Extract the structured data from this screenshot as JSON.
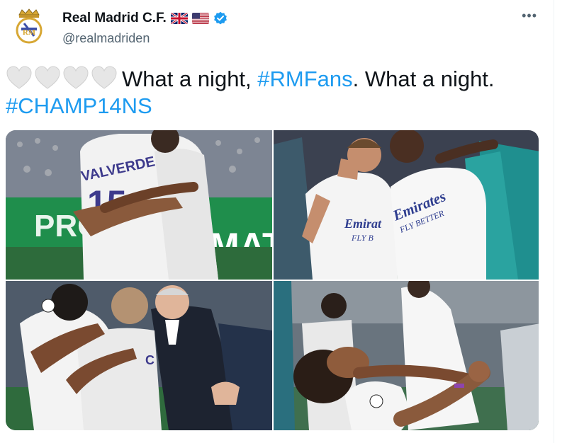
{
  "account": {
    "name": "Real Madrid C.F.",
    "handle": "@realmadriden",
    "avatar_icon": "real-madrid-crest-icon",
    "flags": [
      "uk-flag-icon",
      "us-flag-icon"
    ],
    "verified_icon": "verified-badge-icon"
  },
  "menu": {
    "more_label": "•••"
  },
  "tweet": {
    "emoji_icon": "white-heart-icon",
    "emoji_count": 4,
    "text_part1": "What a night, ",
    "hashtag1": "#RMFans",
    "text_part2": ". What a night.",
    "hashtag2": "#CHAMP14NS"
  },
  "photos": {
    "photo1": {
      "jersey_name": "VALVERDE",
      "board_text_left": "PRO",
      "board_text_right": "MAT,"
    },
    "photo2": {
      "sponsor_line1": "Emirates",
      "sponsor_line2": "FLY BETTER",
      "sponsor_small": "Emirat",
      "sponsor_small2": "FLY B"
    },
    "photo3": {
      "jersey_letter": "C"
    },
    "photo4": {}
  },
  "colors": {
    "hashtag": "#1d9bf0",
    "handle": "#536471",
    "verified": "#1d9bf0"
  }
}
